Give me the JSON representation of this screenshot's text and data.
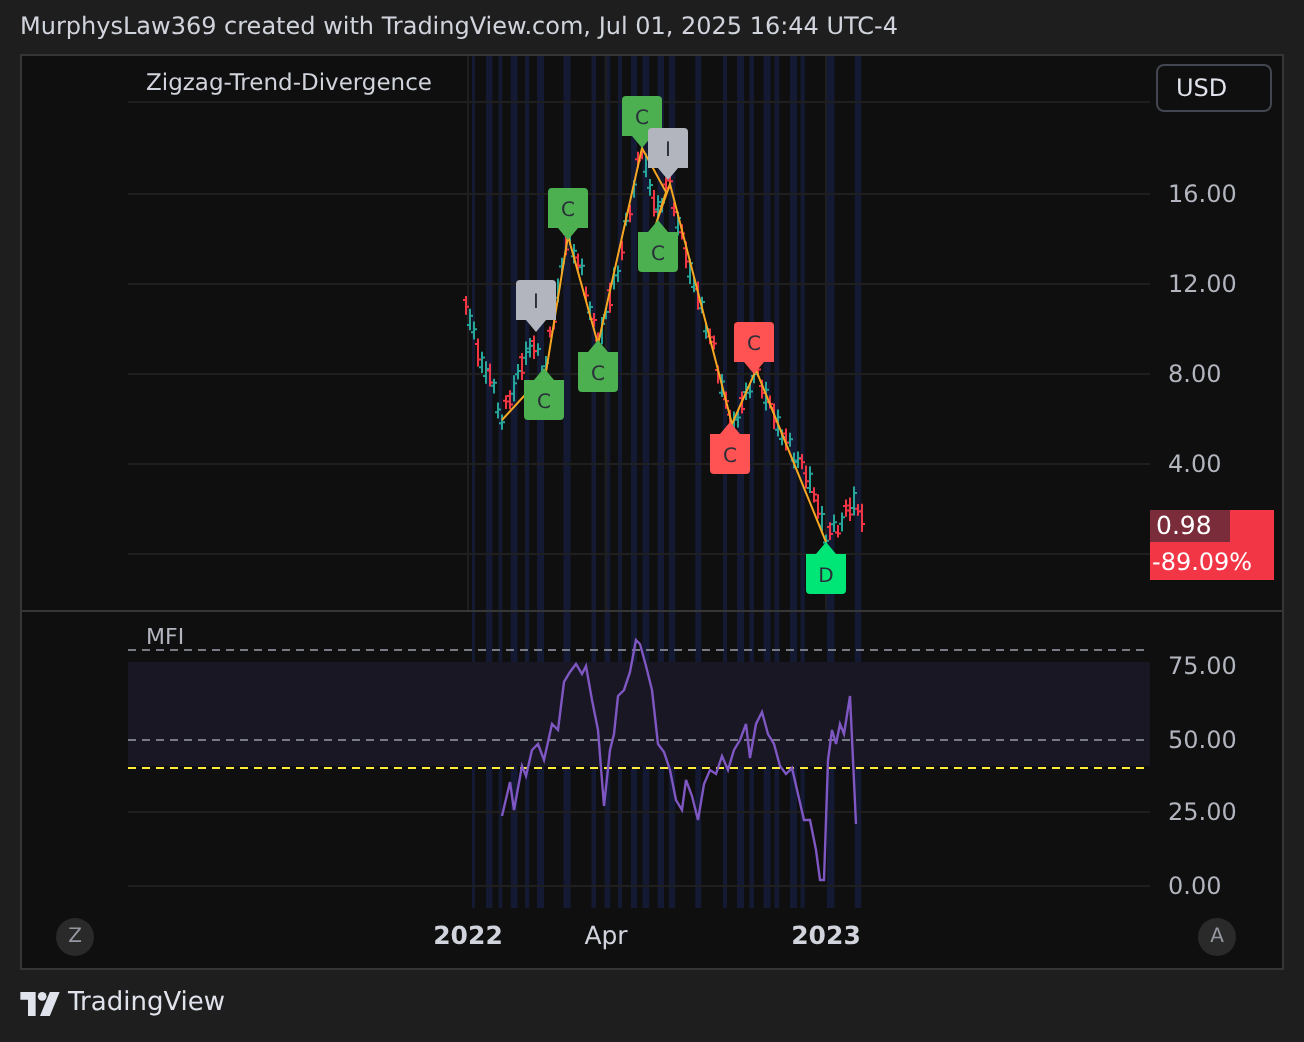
{
  "header": {
    "attribution": "MurphysLaw369 created with TradingView.com, Jul 01, 2025 16:44 UTC-4"
  },
  "chart": {
    "indicator_title": "Zigzag-Trend-Divergence",
    "currency_button": "USD",
    "price_axis": [
      "16.00",
      "12.00",
      "8.00",
      "4.00"
    ],
    "last_price": {
      "value": "0.98",
      "change": "-89.09%"
    },
    "signals": [
      {
        "text": "I",
        "kind": "above",
        "color": "#b2b5be"
      },
      {
        "text": "C",
        "kind": "below",
        "color": "#4caf50"
      },
      {
        "text": "C",
        "kind": "above",
        "color": "#4caf50"
      },
      {
        "text": "C",
        "kind": "below",
        "color": "#4caf50"
      },
      {
        "text": "C",
        "kind": "above",
        "color": "#4caf50"
      },
      {
        "text": "I",
        "kind": "above",
        "color": "#b2b5be"
      },
      {
        "text": "C",
        "kind": "below",
        "color": "#4caf50"
      },
      {
        "text": "C",
        "kind": "above",
        "color": "#ff5252"
      },
      {
        "text": "C",
        "kind": "below",
        "color": "#ff5252"
      },
      {
        "text": "D",
        "kind": "below",
        "color": "#00e676"
      }
    ],
    "mfi_pane": {
      "title": "MFI",
      "axis": [
        "75.00",
        "50.00",
        "25.00",
        "0.00"
      ]
    },
    "time_axis": [
      {
        "label": "2022",
        "bold": true
      },
      {
        "label": "Apr",
        "bold": false
      },
      {
        "label": "2023",
        "bold": true
      }
    ],
    "corner_buttons": [
      "Z",
      "A"
    ]
  },
  "footer": {
    "brand": "TradingView"
  }
}
